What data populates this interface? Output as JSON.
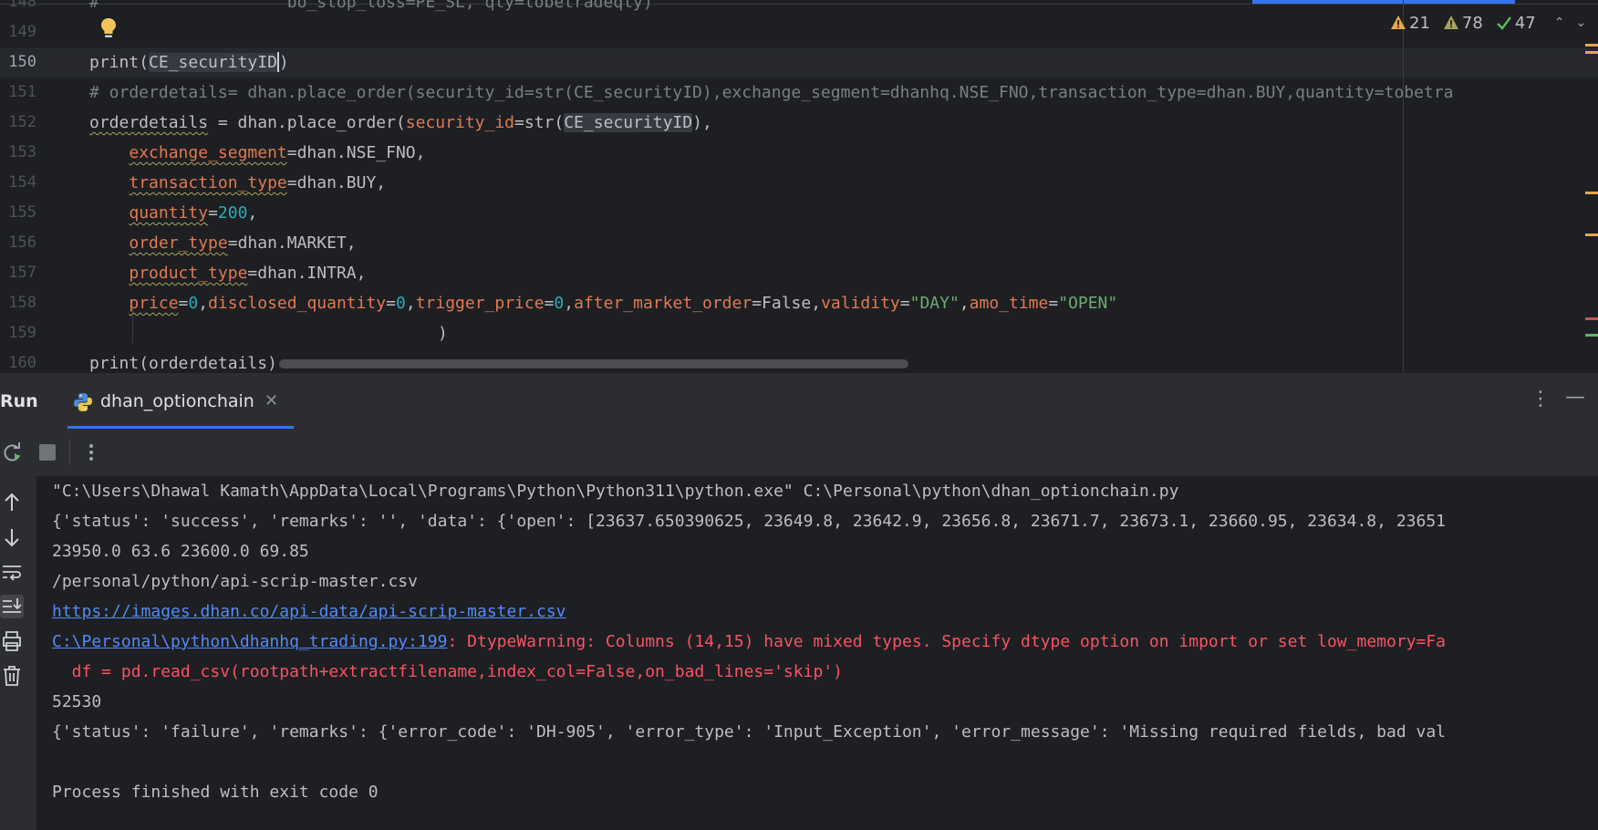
{
  "editor": {
    "line_numbers": [
      "148",
      "149",
      "150",
      "151",
      "152",
      "153",
      "154",
      "155",
      "156",
      "157",
      "158",
      "159",
      "160"
    ],
    "current_line": "150",
    "partial_top_line": "#                   bo_stop_loss=PE_SL, qty=tobetradeqty)",
    "lines": {
      "l150": {
        "func": "print",
        "open": "(",
        "arg": "CE_securityID",
        "close": ")"
      },
      "l151": "# orderdetails= dhan.place_order(security_id=str(CE_securityID),exchange_segment=dhanhq.NSE_FNO,transaction_type=dhan.BUY,quantity=tobetra",
      "l152": {
        "var": "orderdetails",
        "eq": " = dhan.place_order(",
        "param": "security_id",
        "eq2": "=",
        "func": "str",
        "open": "(",
        "arg": "CE_securityID",
        "close": "),"
      },
      "l153": {
        "param": "exchange_segment",
        "value": "=dhan.NSE_FNO,"
      },
      "l154": {
        "param": "transaction_type",
        "value": "=dhan.BUY,"
      },
      "l155": {
        "param": "quantity",
        "eq": "=",
        "num": "200",
        "tail": ","
      },
      "l156": {
        "param": "order_type",
        "value": "=dhan.MARKET,"
      },
      "l157": {
        "param": "product_type",
        "value": "=dhan.INTRA,"
      },
      "l158": {
        "p1": "price",
        "n1": "0",
        "p2": "disclosed_quantity",
        "n2": "0",
        "p3": "trigger_price",
        "n3": "0",
        "p4": "after_market_order",
        "v4": "False",
        "p5": "validity",
        "s5": "\"DAY\"",
        "p6": "amo_time",
        "s6": "\"OPEN\""
      },
      "l159": ")",
      "l160": {
        "func": "print",
        "arg": "(orderdetails)"
      }
    },
    "inspections": {
      "errors": "21",
      "warnings": "78",
      "ok": "47"
    },
    "colors": {
      "accent": "#3574f0",
      "warning": "#e5a84b",
      "error": "#f75464",
      "string": "#6aab73",
      "number": "#2aacb8",
      "param": "#e07a54"
    }
  },
  "run_panel": {
    "title": "Run",
    "tab_label": "dhan_optionchain",
    "console_lines": [
      {
        "kind": "normal",
        "text": "\"C:\\Users\\Dhawal Kamath\\AppData\\Local\\Programs\\Python\\Python311\\python.exe\" C:\\Personal\\python\\dhan_optionchain.py"
      },
      {
        "kind": "normal",
        "text": "{'status': 'success', 'remarks': '', 'data': {'open': [23637.650390625, 23649.8, 23642.9, 23656.8, 23671.7, 23673.1, 23660.95, 23634.8, 23651"
      },
      {
        "kind": "normal",
        "text": "23950.0 63.6 23600.0 69.85"
      },
      {
        "kind": "normal",
        "text": "/personal/python/api-scrip-master.csv"
      },
      {
        "kind": "link",
        "text": "https://images.dhan.co/api-data/api-scrip-master.csv"
      },
      {
        "kind": "warning",
        "link": "C:\\Personal\\python\\dhanhq_trading.py:199",
        "text": ": DtypeWarning: Columns (14,15) have mixed types. Specify dtype option on import or set low_memory=Fa"
      },
      {
        "kind": "error",
        "text": "  df = pd.read_csv(rootpath+extractfilename,index_col=False,on_bad_lines='skip')"
      },
      {
        "kind": "normal",
        "text": "52530"
      },
      {
        "kind": "normal",
        "text": "{'status': 'failure', 'remarks': {'error_code': 'DH-905', 'error_type': 'Input_Exception', 'error_message': 'Missing required fields, bad val"
      },
      {
        "kind": "normal",
        "text": ""
      },
      {
        "kind": "normal",
        "text": "Process finished with exit code 0"
      }
    ]
  }
}
